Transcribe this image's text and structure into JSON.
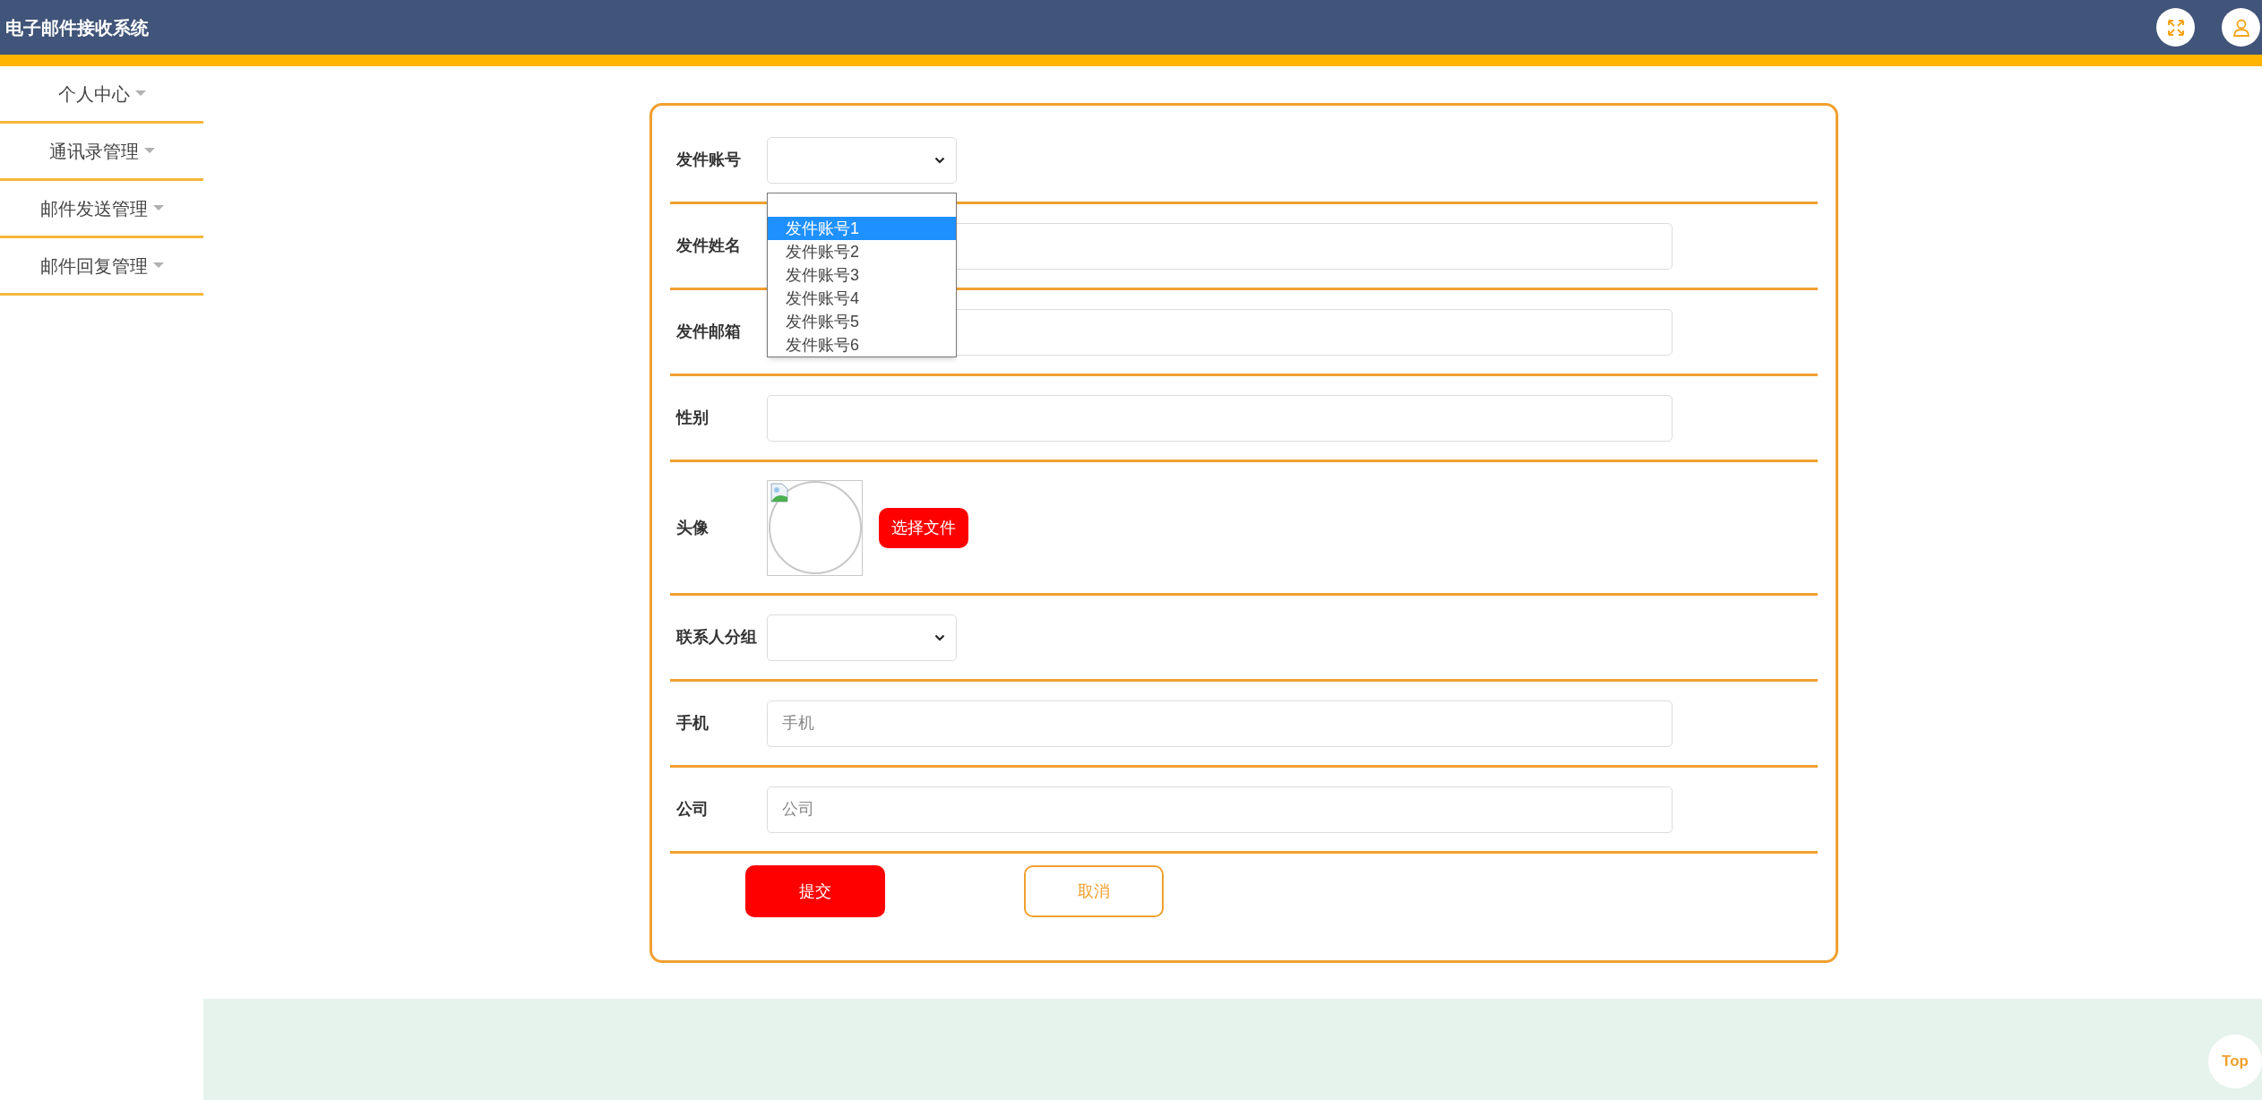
{
  "header": {
    "title": "电子邮件接收系统"
  },
  "sidebar": {
    "items": [
      {
        "label": "个人中心",
        "expanded": false
      },
      {
        "label": "通讯录管理",
        "expanded": false
      },
      {
        "label": "邮件发送管理",
        "expanded": false
      },
      {
        "label": "邮件回复管理",
        "expanded": false
      }
    ]
  },
  "form": {
    "fields": [
      {
        "kind": "select",
        "label": "发件账号",
        "options": [
          {
            "selected": false
          },
          {
            "label": "发件账号1",
            "selected": true
          },
          {
            "label": "发件账号2",
            "selected": false
          },
          {
            "label": "发件账号3",
            "selected": false
          },
          {
            "label": "发件账号4",
            "selected": false
          },
          {
            "label": "发件账号5",
            "selected": false
          },
          {
            "label": "发件账号6",
            "selected": false
          }
        ]
      },
      {
        "kind": "text",
        "label": "发件姓名"
      },
      {
        "kind": "text",
        "label": "发件邮箱"
      },
      {
        "kind": "text",
        "label": "性别"
      },
      {
        "kind": "image",
        "label": "头像",
        "button": "选择文件"
      },
      {
        "kind": "select",
        "label": "联系人分组"
      },
      {
        "kind": "text",
        "label": "手机",
        "placeholder": "手机"
      },
      {
        "kind": "text",
        "label": "公司",
        "placeholder": "公司"
      }
    ],
    "submit": "提交",
    "cancel": "取消"
  },
  "back_to_top": "Top"
}
